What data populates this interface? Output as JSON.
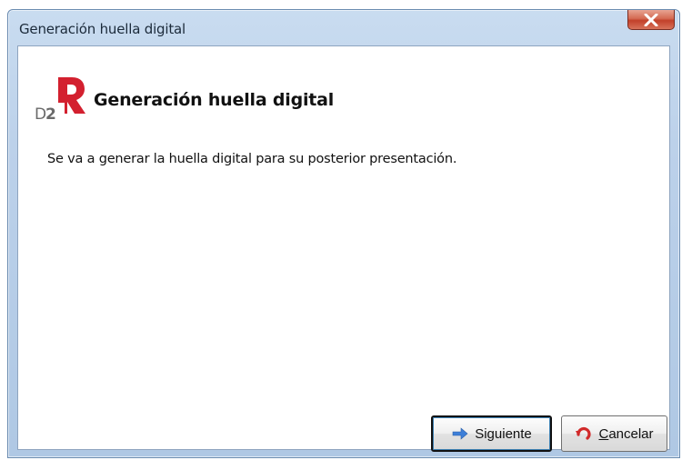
{
  "window": {
    "title": "Generación huella digital"
  },
  "header": {
    "title": "Generación huella digital",
    "logo_text": "D2"
  },
  "body": {
    "message": "Se va a generar la huella digital para su posterior presentación."
  },
  "buttons": {
    "next_label": "Siguiente",
    "cancel_label_underlined": "C",
    "cancel_label_rest": "ancelar"
  },
  "icons": {
    "close": "close-icon",
    "logo": "d2-logo-icon",
    "next": "arrow-right-icon",
    "cancel": "cancel-icon"
  },
  "colors": {
    "logo_red": "#d3202f",
    "logo_gray": "#6a6a6a",
    "next_arrow": "#3d7fd8",
    "cancel_red": "#d12a2a",
    "close_red": "#c2402a"
  }
}
